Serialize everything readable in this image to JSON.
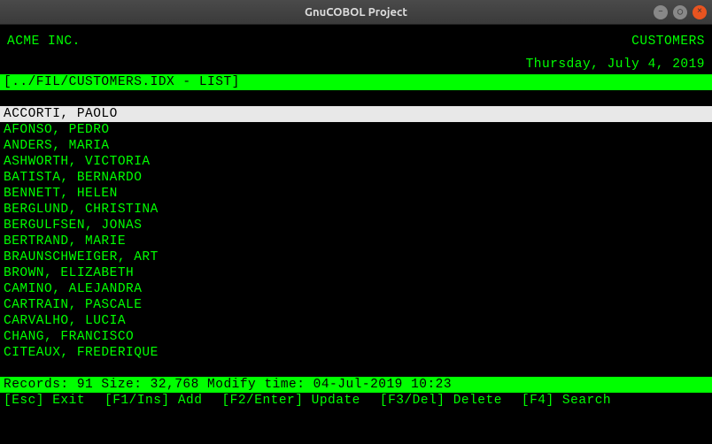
{
  "window": {
    "title": "GnuCOBOL Project"
  },
  "header": {
    "company": "ACME INC.",
    "section": "CUSTOMERS",
    "date": "Thursday, July 4, 2019"
  },
  "path": {
    "text": "[../FIL/CUSTOMERS.IDX - LIST]"
  },
  "list": {
    "items": [
      "ACCORTI, PAOLO",
      "AFONSO, PEDRO",
      "ANDERS, MARIA",
      "ASHWORTH, VICTORIA",
      "BATISTA, BERNARDO",
      "BENNETT, HELEN",
      "BERGLUND, CHRISTINA",
      "BERGULFSEN, JONAS",
      "BERTRAND, MARIE",
      "BRAUNSCHWEIGER, ART",
      "BROWN, ELIZABETH",
      "CAMINO, ALEJANDRA",
      "CARTRAIN, PASCALE",
      "CARVALHO, LUCIA",
      "CHANG, FRANCISCO",
      "CITEAUX, FREDERIQUE"
    ],
    "selected_index": 0
  },
  "status": {
    "text": "Records: 91 Size: 32,768 Modify time: 04-Jul-2019 10:23"
  },
  "footer": {
    "items": [
      {
        "key": "[Esc]",
        "label": "Exit"
      },
      {
        "key": "[F1/Ins]",
        "label": "Add"
      },
      {
        "key": "[F2/Enter]",
        "label": "Update"
      },
      {
        "key": "[F3/Del]",
        "label": "Delete"
      },
      {
        "key": "[F4]",
        "label": "Search"
      }
    ]
  }
}
